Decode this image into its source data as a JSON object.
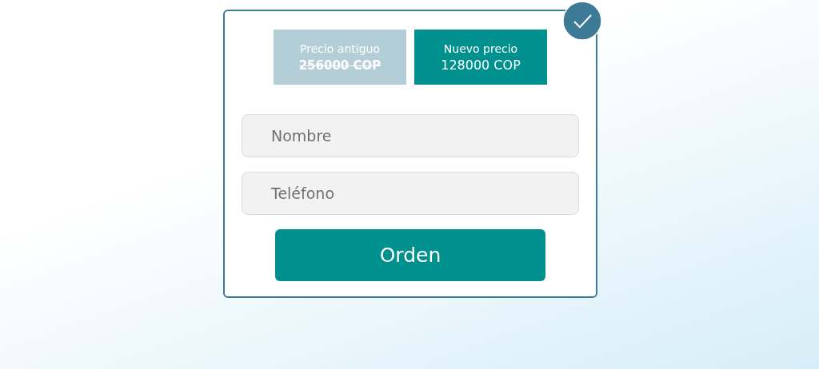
{
  "prices": [
    {
      "kind": "old",
      "label": "Precio antiguo",
      "amount": "256000 COP"
    },
    {
      "kind": "new",
      "label": "Nuevo precio",
      "amount": "128000 COP"
    }
  ],
  "fields": [
    {
      "placeholder": "Nombre"
    },
    {
      "placeholder": "Teléfono"
    }
  ],
  "submit": "Orden"
}
